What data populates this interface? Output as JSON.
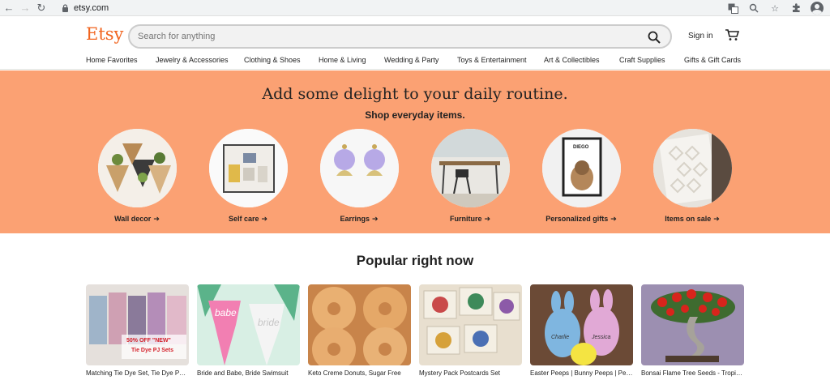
{
  "browser": {
    "url": "etsy.com",
    "nav_icons": [
      "back-icon",
      "forward-icon",
      "reload-icon"
    ],
    "right_icons": [
      "translate-icon",
      "zoom-icon",
      "star-icon",
      "extensions-icon",
      "profile-icon"
    ]
  },
  "header": {
    "logo": "Etsy",
    "search_placeholder": "Search for anything",
    "sign_in": "Sign in",
    "cart_icon": "cart-icon",
    "brand_color": "#f1641e"
  },
  "categories": [
    "Home Favorites",
    "Jewelry & Accessories",
    "Clothing & Shoes",
    "Home & Living",
    "Wedding & Party",
    "Toys & Entertainment",
    "Art & Collectibles",
    "Craft Supplies",
    "Gifts & Gift Cards"
  ],
  "hero": {
    "title": "Add some delight to your daily routine.",
    "subtitle": "Shop everyday items.",
    "background": "#fba173",
    "items": [
      {
        "label": "Wall decor"
      },
      {
        "label": "Self care"
      },
      {
        "label": "Earrings"
      },
      {
        "label": "Furniture"
      },
      {
        "label": "Personalized gifts"
      },
      {
        "label": "Items on sale"
      }
    ],
    "arrow": "➔"
  },
  "popular": {
    "title": "Popular right now",
    "items": [
      {
        "caption": "Matching Tie Dye Set, Tie Dye PJ Sets",
        "badge_top": "50% OFF \"NEW\"",
        "badge_bottom": "Tie Dye PJ Sets"
      },
      {
        "caption": "Bride and Babe, Bride Swimsuit",
        "print_1": "babe",
        "print_2": "bride"
      },
      {
        "caption": "Keto Creme Donuts, Sugar Free"
      },
      {
        "caption": "Mystery Pack Postcards Set"
      },
      {
        "caption": "Easter Peeps | Bunny Peeps | Personalized",
        "name_1": "Charlie",
        "name_2": "Jessica"
      },
      {
        "caption": "Bonsai Flame Tree Seeds - Tropical"
      }
    ]
  },
  "personalized_sign": "DIEGO"
}
